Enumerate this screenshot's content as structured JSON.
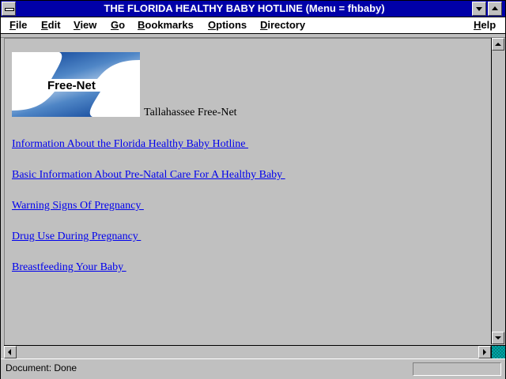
{
  "window": {
    "title": "THE FLORIDA HEALTHY BABY HOTLINE (Menu = fhbaby)"
  },
  "menubar": [
    {
      "key": "F",
      "rest": "ile"
    },
    {
      "key": "E",
      "rest": "dit"
    },
    {
      "key": "V",
      "rest": "iew"
    },
    {
      "key": "G",
      "rest": "o"
    },
    {
      "key": "B",
      "rest": "ookmarks"
    },
    {
      "key": "O",
      "rest": "ptions"
    },
    {
      "key": "D",
      "rest": "irectory"
    },
    {
      "key": "H",
      "rest": "elp"
    }
  ],
  "page": {
    "logo_text": "Free-Net",
    "site_name": "Tallahassee Free-Net",
    "links": [
      "Information About the Florida Healthy Baby Hotline ",
      "Basic Information About Pre-Natal Care For A Healthy Baby ",
      "Warning Signs Of Pregnancy ",
      "Drug Use During Pregnancy ",
      "Breastfeeding Your Baby "
    ]
  },
  "status": {
    "text": "Document: Done"
  },
  "colors": {
    "title_bar": "#0000a8",
    "link": "#0000ee",
    "background": "#c0c0c0"
  }
}
